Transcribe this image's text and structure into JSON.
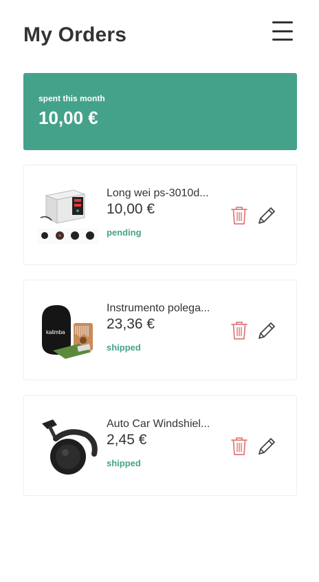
{
  "header": {
    "title": "My Orders",
    "menu_icon": "hamburger-menu-icon"
  },
  "summary": {
    "label": "spent this month",
    "value": "10,00 €",
    "color": "#45a28a"
  },
  "orders": [
    {
      "name": "Long wei ps-3010d...",
      "price": "10,00 €",
      "status": "pending",
      "image": "power-supply-image"
    },
    {
      "name": "Instrumento polega...",
      "price": "23,36 €",
      "status": "shipped",
      "image": "kalimba-image"
    },
    {
      "name": "Auto Car Windshiel...",
      "price": "2,45 €",
      "status": "shipped",
      "image": "car-mount-image"
    }
  ],
  "icons": {
    "delete": "trash-icon",
    "edit": "pencil-icon",
    "delete_color": "#e07b7b",
    "edit_color": "#444444"
  }
}
